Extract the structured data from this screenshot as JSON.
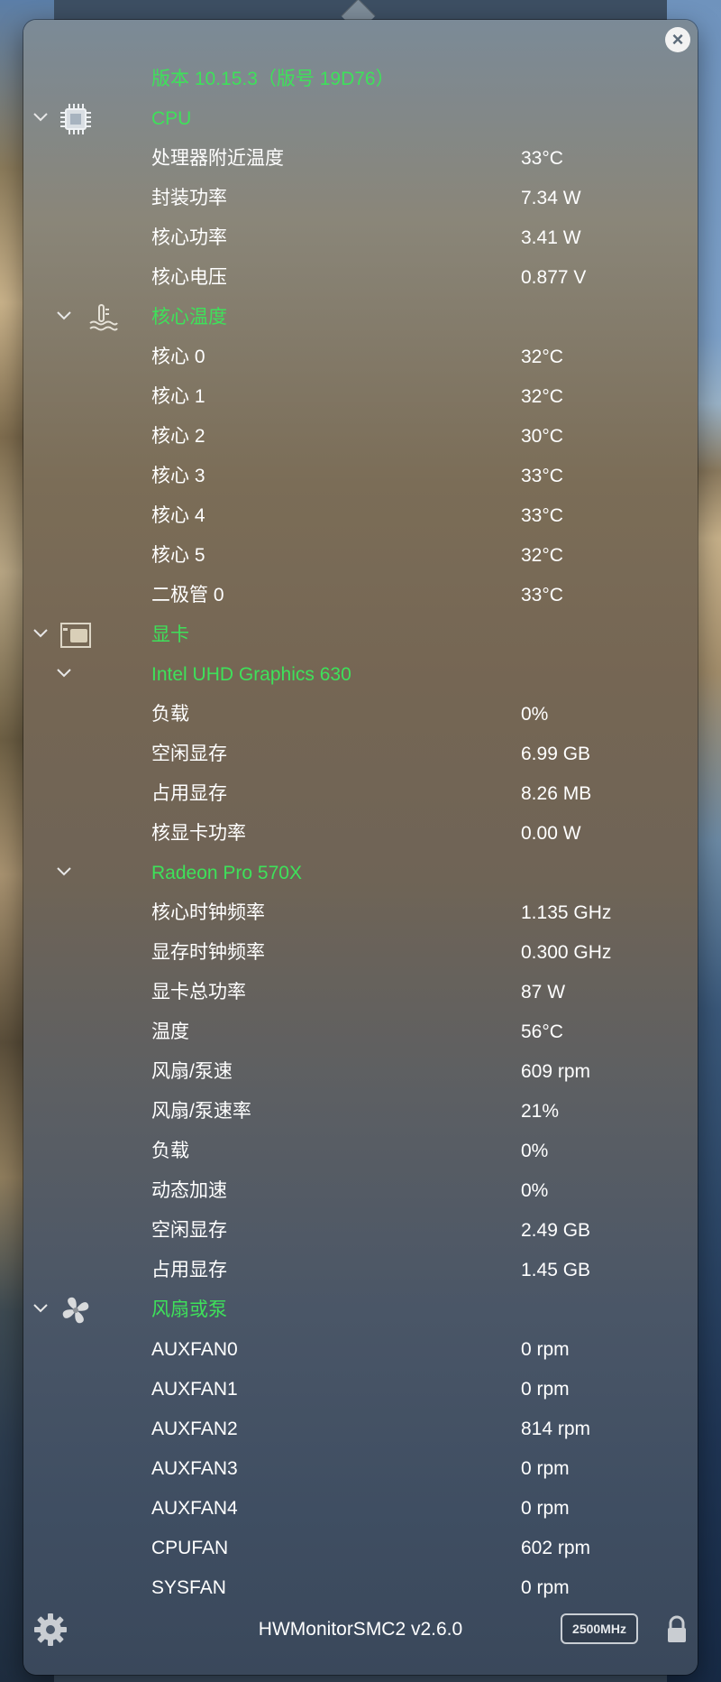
{
  "header": {
    "version_line": "版本 10.15.3（版号 19D76）",
    "close_icon": "close-icon"
  },
  "cpu": {
    "title": "CPU",
    "icon": "cpu-chip-icon",
    "items": [
      {
        "label": "处理器附近温度",
        "value": "33°C"
      },
      {
        "label": "封装功率",
        "value": "7.34 W"
      },
      {
        "label": "核心功率",
        "value": "3.41 W"
      },
      {
        "label": "核心电压",
        "value": "0.877 V"
      }
    ],
    "core_temp": {
      "title": "核心温度",
      "icon": "thermometer-icon",
      "items": [
        {
          "label": "核心 0",
          "value": "32°C"
        },
        {
          "label": "核心 1",
          "value": "32°C"
        },
        {
          "label": "核心 2",
          "value": "30°C"
        },
        {
          "label": "核心 3",
          "value": "33°C"
        },
        {
          "label": "核心 4",
          "value": "33°C"
        },
        {
          "label": "核心 5",
          "value": "32°C"
        },
        {
          "label": "二极管 0",
          "value": "33°C"
        }
      ]
    }
  },
  "gpu": {
    "title": "显卡",
    "icon": "graphics-card-icon",
    "intel": {
      "title": "Intel UHD Graphics 630",
      "items": [
        {
          "label": "负载",
          "value": "0%"
        },
        {
          "label": "空闲显存",
          "value": "6.99 GB"
        },
        {
          "label": "占用显存",
          "value": "8.26 MB"
        },
        {
          "label": "核显卡功率",
          "value": "0.00 W"
        }
      ]
    },
    "radeon": {
      "title": "Radeon Pro 570X",
      "items": [
        {
          "label": "核心时钟频率",
          "value": "1.135 GHz"
        },
        {
          "label": "显存时钟频率",
          "value": "0.300 GHz"
        },
        {
          "label": "显卡总功率",
          "value": "87 W"
        },
        {
          "label": "温度",
          "value": "56°C"
        },
        {
          "label": "风扇/泵速",
          "value": "609 rpm"
        },
        {
          "label": "风扇/泵速率",
          "value": "21%"
        },
        {
          "label": "负载",
          "value": "0%"
        },
        {
          "label": "动态加速",
          "value": "0%"
        },
        {
          "label": "空闲显存",
          "value": "2.49 GB"
        },
        {
          "label": "占用显存",
          "value": "1.45 GB"
        }
      ]
    }
  },
  "fans": {
    "title": "风扇或泵",
    "icon": "fan-icon",
    "items": [
      {
        "label": "AUXFAN0",
        "value": "0 rpm"
      },
      {
        "label": "AUXFAN1",
        "value": "0 rpm"
      },
      {
        "label": "AUXFAN2",
        "value": "814 rpm"
      },
      {
        "label": "AUXFAN3",
        "value": "0 rpm"
      },
      {
        "label": "AUXFAN4",
        "value": "0 rpm"
      },
      {
        "label": "CPUFAN",
        "value": "602 rpm"
      },
      {
        "label": "SYSFAN",
        "value": "0 rpm"
      }
    ]
  },
  "footer": {
    "app_name": "HWMonitorSMC2 v2.6.0",
    "frequency_badge": "2500MHz",
    "settings_icon": "gear-icon",
    "lock_icon": "lock-icon"
  },
  "colors": {
    "section_green": "#3ee15a",
    "text": "#ffffff"
  }
}
